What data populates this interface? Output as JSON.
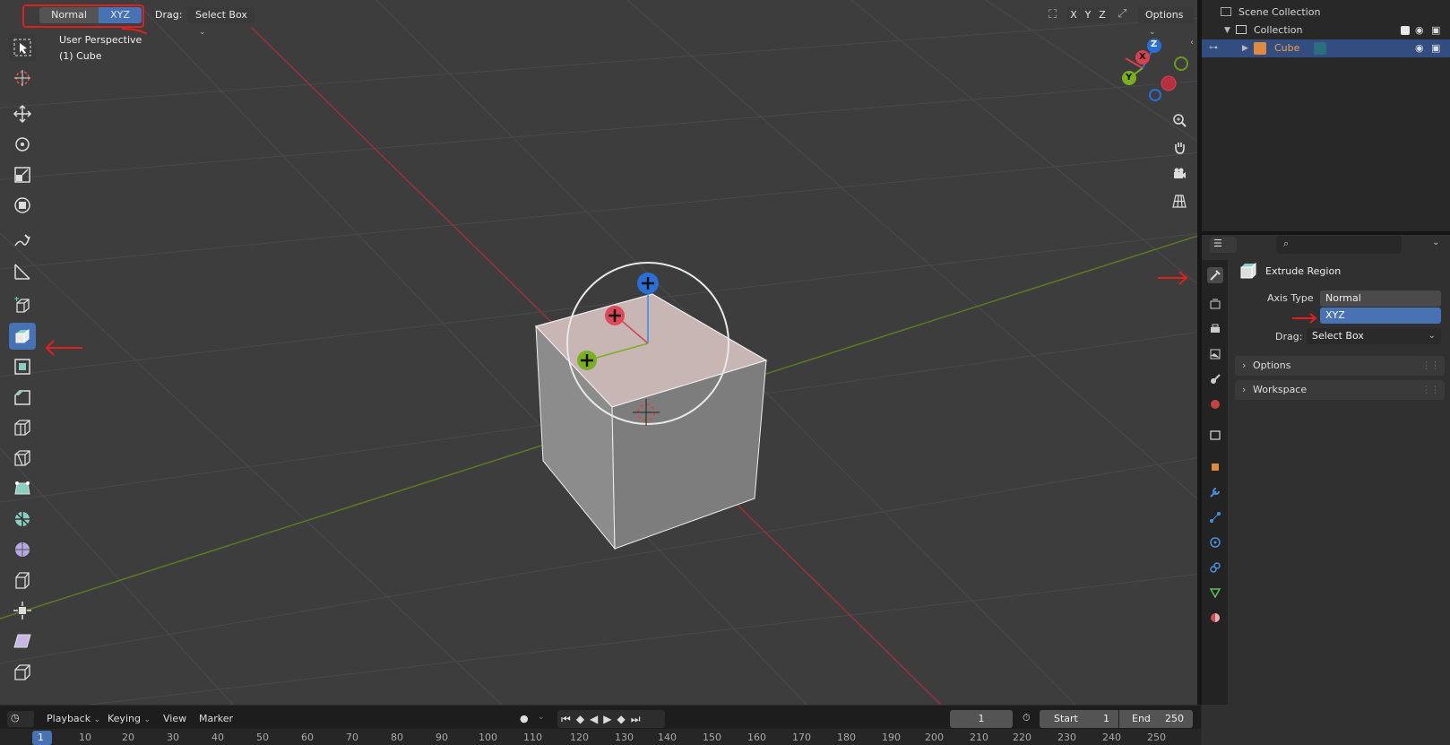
{
  "header": {
    "axis_normal": "Normal",
    "axis_xyz": "XYZ",
    "drag_label": "Drag:",
    "drag_value": "Select Box",
    "axis_x": "X",
    "axis_y": "Y",
    "axis_z": "Z",
    "options": "Options"
  },
  "viewport": {
    "perspective": "User Perspective",
    "object": "(1) Cube",
    "gizmo": {
      "x": "X",
      "y": "Y",
      "z": "Z"
    }
  },
  "outliner": {
    "scene_collection": "Scene Collection",
    "collection": "Collection",
    "cube": "Cube"
  },
  "properties": {
    "search_placeholder": "",
    "tool_name": "Extrude Region",
    "axis_type_label": "Axis Type",
    "axis_options": [
      "Normal",
      "XYZ"
    ],
    "drag_label": "Drag:",
    "drag_value": "Select Box",
    "panels": [
      "Options",
      "Workspace"
    ]
  },
  "timeline": {
    "menus": [
      "Playback",
      "Keying",
      "View",
      "Marker"
    ],
    "current_frame": "1",
    "start_label": "Start",
    "start_value": "1",
    "end_label": "End",
    "end_value": "250",
    "ruler": [
      "1",
      "10",
      "20",
      "30",
      "40",
      "50",
      "60",
      "70",
      "80",
      "90",
      "100",
      "110",
      "120",
      "130",
      "140",
      "150",
      "160",
      "170",
      "180",
      "190",
      "200",
      "210",
      "220",
      "230",
      "240",
      "250"
    ]
  },
  "colors": {
    "accent": "#4772b3",
    "x_axis": "#c83040",
    "y_axis": "#6a9a20",
    "z_axis": "#2a6fd6",
    "annotation": "#e02020"
  }
}
